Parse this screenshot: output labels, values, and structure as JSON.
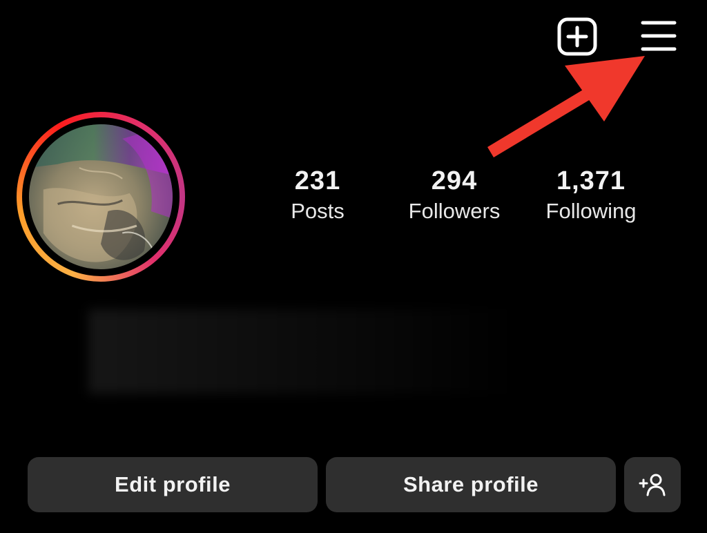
{
  "header": {
    "new_post_icon": "plus-square-icon",
    "menu_icon": "hamburger-menu-icon"
  },
  "profile": {
    "avatar": "profile-picture",
    "story_ring_colors": [
      "#fcb045",
      "#fd1d1d",
      "#e1306c",
      "#c13584"
    ]
  },
  "stats": [
    {
      "value": "231",
      "label": "Posts"
    },
    {
      "value": "294",
      "label": "Followers"
    },
    {
      "value": "1,371",
      "label": "Following"
    }
  ],
  "buttons": {
    "edit_profile": "Edit profile",
    "share_profile": "Share profile",
    "discover_people_icon": "add-person-icon"
  },
  "annotation": {
    "arrow_color": "#f0382c",
    "points_to": "menu-icon"
  },
  "colors": {
    "background": "#000000",
    "button_bg": "#2f2f2f",
    "text": "#f2f2f2"
  }
}
